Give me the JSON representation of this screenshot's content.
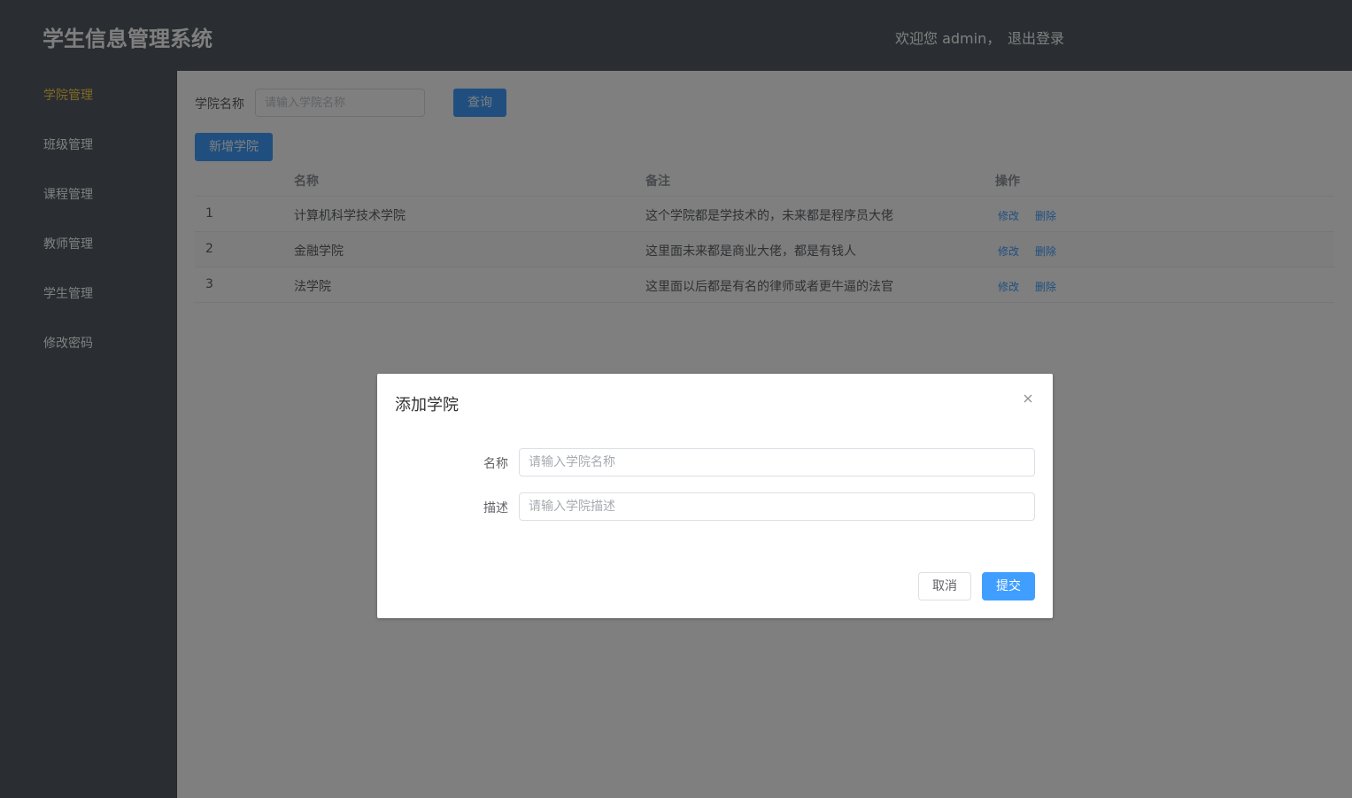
{
  "header": {
    "app_title": "学生信息管理系统",
    "welcome": "欢迎您 admin，",
    "logout": "退出登录"
  },
  "sidebar": {
    "items": [
      {
        "label": "学院管理",
        "active": true
      },
      {
        "label": "班级管理",
        "active": false
      },
      {
        "label": "课程管理",
        "active": false
      },
      {
        "label": "教师管理",
        "active": false
      },
      {
        "label": "学生管理",
        "active": false
      },
      {
        "label": "修改密码",
        "active": false
      }
    ]
  },
  "search": {
    "label": "学院名称",
    "placeholder": "请输入学院名称",
    "query_button": "查询"
  },
  "toolbar": {
    "add_button": "新增学院"
  },
  "table": {
    "columns": [
      "名称",
      "备注",
      "操作"
    ],
    "rows": [
      {
        "index": "1",
        "name": "计算机科学技术学院",
        "remark": "这个学院都是学技术的，未来都是程序员大佬"
      },
      {
        "index": "2",
        "name": "金融学院",
        "remark": "这里面未来都是商业大佬，都是有钱人"
      },
      {
        "index": "3",
        "name": "法学院",
        "remark": "这里面以后都是有名的律师或者更牛逼的法官"
      }
    ],
    "edit_label": "修改",
    "delete_label": "删除"
  },
  "dialog": {
    "title": "添加学院",
    "name_label": "名称",
    "name_placeholder": "请输入学院名称",
    "desc_label": "描述",
    "desc_placeholder": "请输入学院描述",
    "cancel_button": "取消",
    "submit_button": "提交"
  },
  "colors": {
    "header_bg": "#545c64",
    "active_menu": "#ffd04b",
    "primary": "#409eff"
  }
}
